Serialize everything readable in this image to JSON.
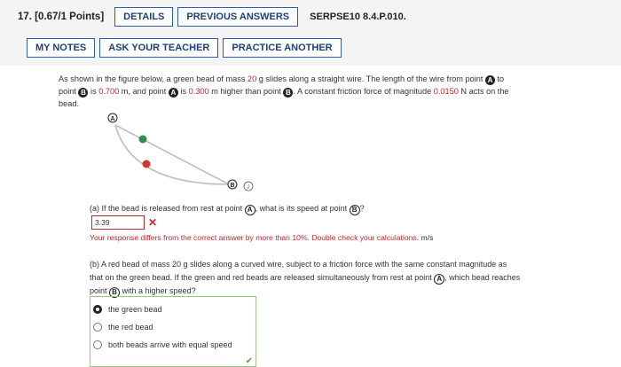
{
  "header": {
    "question": "17. [0.67/1 Points]",
    "details_btn": "DETAILS",
    "previous_btn": "PREVIOUS ANSWERS",
    "problem_id": "SERPSE10 8.4.P.010.",
    "notes_btn": "MY NOTES",
    "teacher_btn": "ASK YOUR TEACHER",
    "practice_btn": "PRACTICE ANOTHER"
  },
  "problem": {
    "t1": "As shown in the figure below, a green bead of mass ",
    "mass": "20",
    "t2": " g slides along a straight wire. The length of the wire from point ",
    "A": "A",
    "B": "B",
    "t3": " to",
    "t4": "point ",
    "t5": " is ",
    "length": "0.700",
    "t6": " m, and point ",
    "t7": " is ",
    "height": "0.300",
    "t8": " m higher than point ",
    "t9": ". A constant friction force of magnitude ",
    "friction": "0.0150",
    "t10": " N acts on the",
    "t11": "bead."
  },
  "figure": {
    "label_A": "A",
    "label_B": "B",
    "info": "i",
    "colors": {
      "green": "#2f8f4a",
      "red": "#d6332c"
    }
  },
  "part_a": {
    "q1": "(a) If the bead is released from rest at point ",
    "q2": ", what is its speed at point ",
    "q3": "?",
    "answer": "3.39",
    "feedback": "Your response differs from the correct answer by more than 10%. Double check your calculations.",
    "unit": " m/s"
  },
  "part_b": {
    "q1": "(b) A red bead of mass 20 g slides along a curved wire, subject to a friction force with the same constant magnitude as",
    "q2": "that on the green bead. If the green and red beads are released simultaneously from rest at point ",
    "q3": ", which bead reaches",
    "q4": "point ",
    "q5": " with a higher speed?",
    "options": [
      "the green bead",
      "the red bead",
      "both beads arrive with equal speed"
    ],
    "selected": 0
  }
}
